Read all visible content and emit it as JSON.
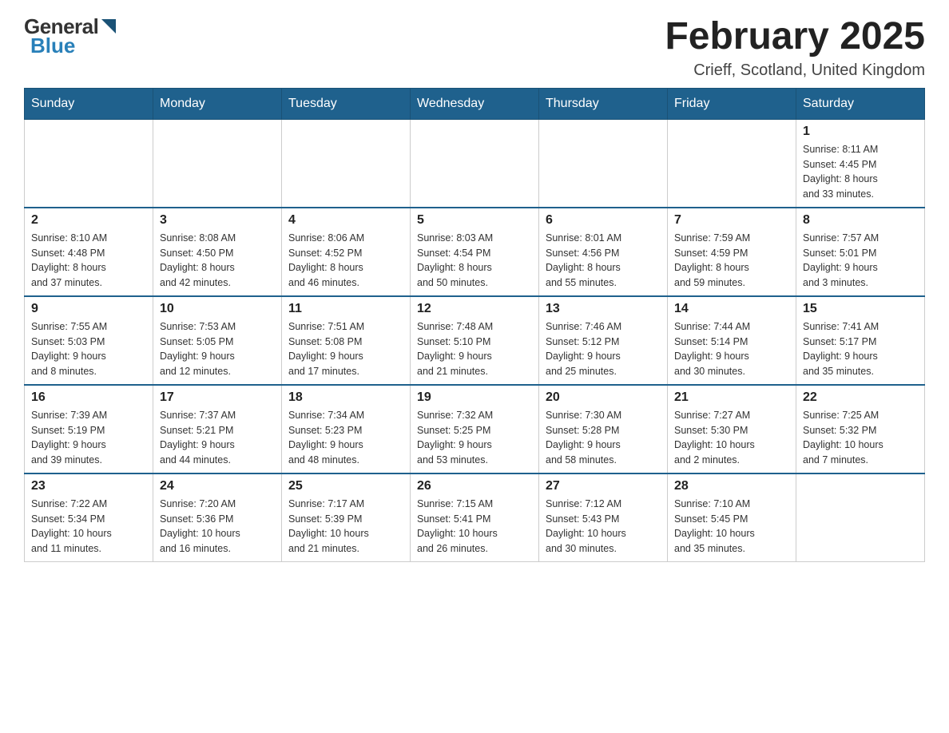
{
  "logo": {
    "general": "General",
    "blue": "Blue"
  },
  "title": "February 2025",
  "subtitle": "Crieff, Scotland, United Kingdom",
  "days_of_week": [
    "Sunday",
    "Monday",
    "Tuesday",
    "Wednesday",
    "Thursday",
    "Friday",
    "Saturday"
  ],
  "weeks": [
    [
      {
        "day": "",
        "info": ""
      },
      {
        "day": "",
        "info": ""
      },
      {
        "day": "",
        "info": ""
      },
      {
        "day": "",
        "info": ""
      },
      {
        "day": "",
        "info": ""
      },
      {
        "day": "",
        "info": ""
      },
      {
        "day": "1",
        "info": "Sunrise: 8:11 AM\nSunset: 4:45 PM\nDaylight: 8 hours\nand 33 minutes."
      }
    ],
    [
      {
        "day": "2",
        "info": "Sunrise: 8:10 AM\nSunset: 4:48 PM\nDaylight: 8 hours\nand 37 minutes."
      },
      {
        "day": "3",
        "info": "Sunrise: 8:08 AM\nSunset: 4:50 PM\nDaylight: 8 hours\nand 42 minutes."
      },
      {
        "day": "4",
        "info": "Sunrise: 8:06 AM\nSunset: 4:52 PM\nDaylight: 8 hours\nand 46 minutes."
      },
      {
        "day": "5",
        "info": "Sunrise: 8:03 AM\nSunset: 4:54 PM\nDaylight: 8 hours\nand 50 minutes."
      },
      {
        "day": "6",
        "info": "Sunrise: 8:01 AM\nSunset: 4:56 PM\nDaylight: 8 hours\nand 55 minutes."
      },
      {
        "day": "7",
        "info": "Sunrise: 7:59 AM\nSunset: 4:59 PM\nDaylight: 8 hours\nand 59 minutes."
      },
      {
        "day": "8",
        "info": "Sunrise: 7:57 AM\nSunset: 5:01 PM\nDaylight: 9 hours\nand 3 minutes."
      }
    ],
    [
      {
        "day": "9",
        "info": "Sunrise: 7:55 AM\nSunset: 5:03 PM\nDaylight: 9 hours\nand 8 minutes."
      },
      {
        "day": "10",
        "info": "Sunrise: 7:53 AM\nSunset: 5:05 PM\nDaylight: 9 hours\nand 12 minutes."
      },
      {
        "day": "11",
        "info": "Sunrise: 7:51 AM\nSunset: 5:08 PM\nDaylight: 9 hours\nand 17 minutes."
      },
      {
        "day": "12",
        "info": "Sunrise: 7:48 AM\nSunset: 5:10 PM\nDaylight: 9 hours\nand 21 minutes."
      },
      {
        "day": "13",
        "info": "Sunrise: 7:46 AM\nSunset: 5:12 PM\nDaylight: 9 hours\nand 25 minutes."
      },
      {
        "day": "14",
        "info": "Sunrise: 7:44 AM\nSunset: 5:14 PM\nDaylight: 9 hours\nand 30 minutes."
      },
      {
        "day": "15",
        "info": "Sunrise: 7:41 AM\nSunset: 5:17 PM\nDaylight: 9 hours\nand 35 minutes."
      }
    ],
    [
      {
        "day": "16",
        "info": "Sunrise: 7:39 AM\nSunset: 5:19 PM\nDaylight: 9 hours\nand 39 minutes."
      },
      {
        "day": "17",
        "info": "Sunrise: 7:37 AM\nSunset: 5:21 PM\nDaylight: 9 hours\nand 44 minutes."
      },
      {
        "day": "18",
        "info": "Sunrise: 7:34 AM\nSunset: 5:23 PM\nDaylight: 9 hours\nand 48 minutes."
      },
      {
        "day": "19",
        "info": "Sunrise: 7:32 AM\nSunset: 5:25 PM\nDaylight: 9 hours\nand 53 minutes."
      },
      {
        "day": "20",
        "info": "Sunrise: 7:30 AM\nSunset: 5:28 PM\nDaylight: 9 hours\nand 58 minutes."
      },
      {
        "day": "21",
        "info": "Sunrise: 7:27 AM\nSunset: 5:30 PM\nDaylight: 10 hours\nand 2 minutes."
      },
      {
        "day": "22",
        "info": "Sunrise: 7:25 AM\nSunset: 5:32 PM\nDaylight: 10 hours\nand 7 minutes."
      }
    ],
    [
      {
        "day": "23",
        "info": "Sunrise: 7:22 AM\nSunset: 5:34 PM\nDaylight: 10 hours\nand 11 minutes."
      },
      {
        "day": "24",
        "info": "Sunrise: 7:20 AM\nSunset: 5:36 PM\nDaylight: 10 hours\nand 16 minutes."
      },
      {
        "day": "25",
        "info": "Sunrise: 7:17 AM\nSunset: 5:39 PM\nDaylight: 10 hours\nand 21 minutes."
      },
      {
        "day": "26",
        "info": "Sunrise: 7:15 AM\nSunset: 5:41 PM\nDaylight: 10 hours\nand 26 minutes."
      },
      {
        "day": "27",
        "info": "Sunrise: 7:12 AM\nSunset: 5:43 PM\nDaylight: 10 hours\nand 30 minutes."
      },
      {
        "day": "28",
        "info": "Sunrise: 7:10 AM\nSunset: 5:45 PM\nDaylight: 10 hours\nand 35 minutes."
      },
      {
        "day": "",
        "info": ""
      }
    ]
  ]
}
